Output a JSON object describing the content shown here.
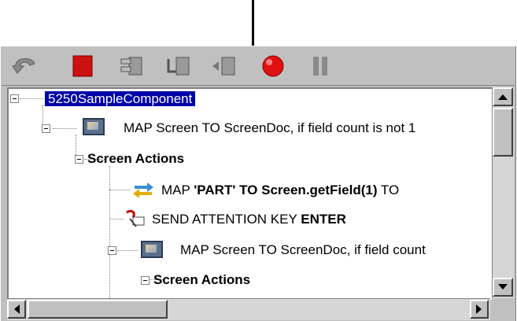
{
  "toolbar": {
    "buttons": [
      {
        "name": "back-icon"
      },
      {
        "name": "stop-icon"
      },
      {
        "name": "step-over-icon"
      },
      {
        "name": "step-into-icon"
      },
      {
        "name": "step-out-icon"
      },
      {
        "name": "record-icon"
      },
      {
        "name": "pause-icon"
      }
    ]
  },
  "tree": {
    "root": "5250SampleComponent",
    "n1_pre": "MAP Screen TO ScreenDoc, if field count is not 1",
    "n2": "Screen Actions",
    "n3_a": "MAP ",
    "n3_b": "'PART' TO Screen.getField(1)",
    "n3_c": " TO",
    "n4_a": "SEND ATTENTION KEY ",
    "n4_b": "ENTER",
    "n5": "MAP Screen TO ScreenDoc, if field count",
    "n6": "Screen Actions"
  },
  "colors": {
    "selection": "#0000a8",
    "panel": "#c0c0c0",
    "stop": "#cc1111",
    "record": "#e01010"
  }
}
